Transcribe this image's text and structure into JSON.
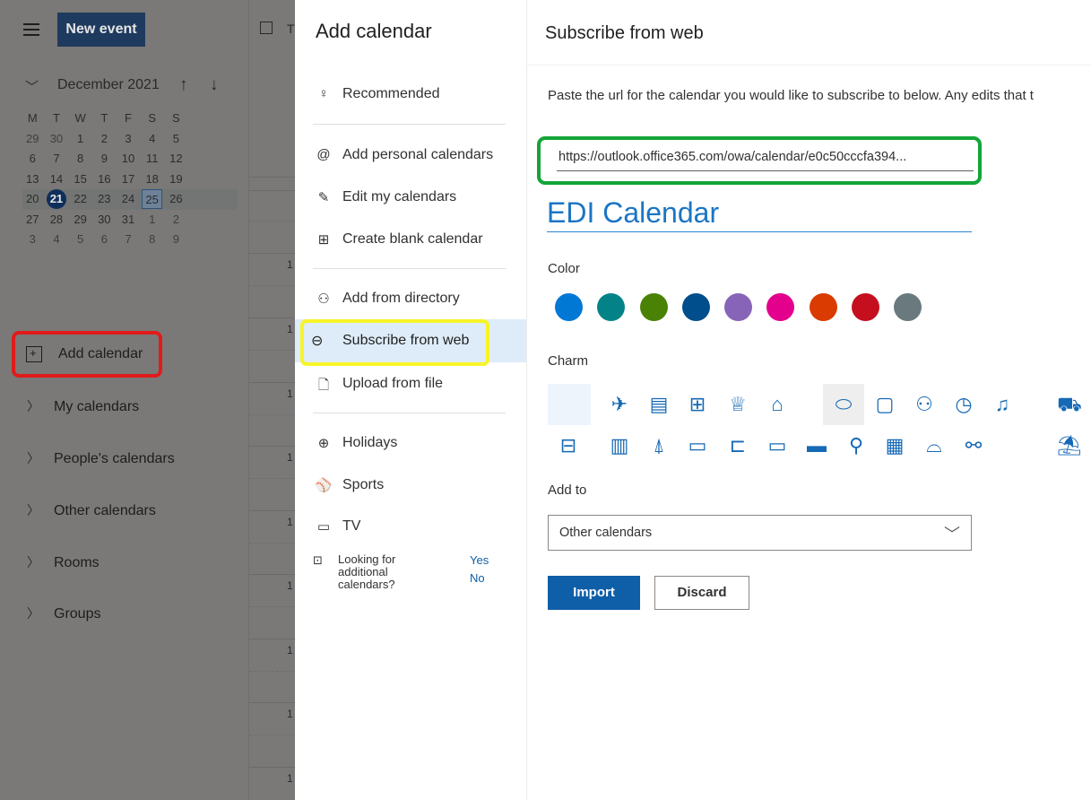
{
  "left": {
    "new_event": "New event",
    "month_label": "December 2021",
    "weekdays": [
      "M",
      "T",
      "W",
      "T",
      "F",
      "S",
      "S"
    ],
    "weeks": [
      [
        "29",
        "30",
        "1",
        "2",
        "3",
        "4",
        "5"
      ],
      [
        "6",
        "7",
        "8",
        "9",
        "10",
        "11",
        "12"
      ],
      [
        "13",
        "14",
        "15",
        "16",
        "17",
        "18",
        "19"
      ],
      [
        "20",
        "21",
        "22",
        "23",
        "24",
        "25",
        "26"
      ],
      [
        "27",
        "28",
        "29",
        "30",
        "31",
        "1",
        "2"
      ],
      [
        "3",
        "4",
        "5",
        "6",
        "7",
        "8",
        "9"
      ]
    ],
    "add_calendar": "Add calendar",
    "groups": [
      "My calendars",
      "People's calendars",
      "Other calendars",
      "Rooms",
      "Groups"
    ]
  },
  "grid": {
    "top_label": "T",
    "hour_marks": [
      "1",
      "1",
      "1",
      "1",
      "1",
      "1",
      "1",
      "1",
      "1"
    ]
  },
  "menu": {
    "title": "Add calendar",
    "recommended": "Recommended",
    "add_personal": "Add personal calendars",
    "edit_my": "Edit my calendars",
    "create_blank": "Create blank calendar",
    "add_directory": "Add from directory",
    "subscribe_web": "Subscribe from web",
    "upload_file": "Upload from file",
    "holidays": "Holidays",
    "sports": "Sports",
    "tv": "TV",
    "looking": "Looking for additional calendars?",
    "yes": "Yes",
    "no": "No"
  },
  "panel": {
    "title": "Subscribe from web",
    "description": "Paste the url for the calendar you would like to subscribe to below. Any edits that t",
    "url": "https://outlook.office365.com/owa/calendar/e0c50cccfa394...",
    "calendar_name": "EDI Calendar",
    "color_label": "Color",
    "colors": [
      "#0078d4",
      "#038387",
      "#498205",
      "#004e8c",
      "#8764b8",
      "#e3008c",
      "#da3b01",
      "#c50f1f",
      "#69797e"
    ],
    "charm_label": "Charm",
    "add_to_label": "Add to",
    "add_to_value": "Other calendars",
    "import": "Import",
    "discard": "Discard"
  }
}
